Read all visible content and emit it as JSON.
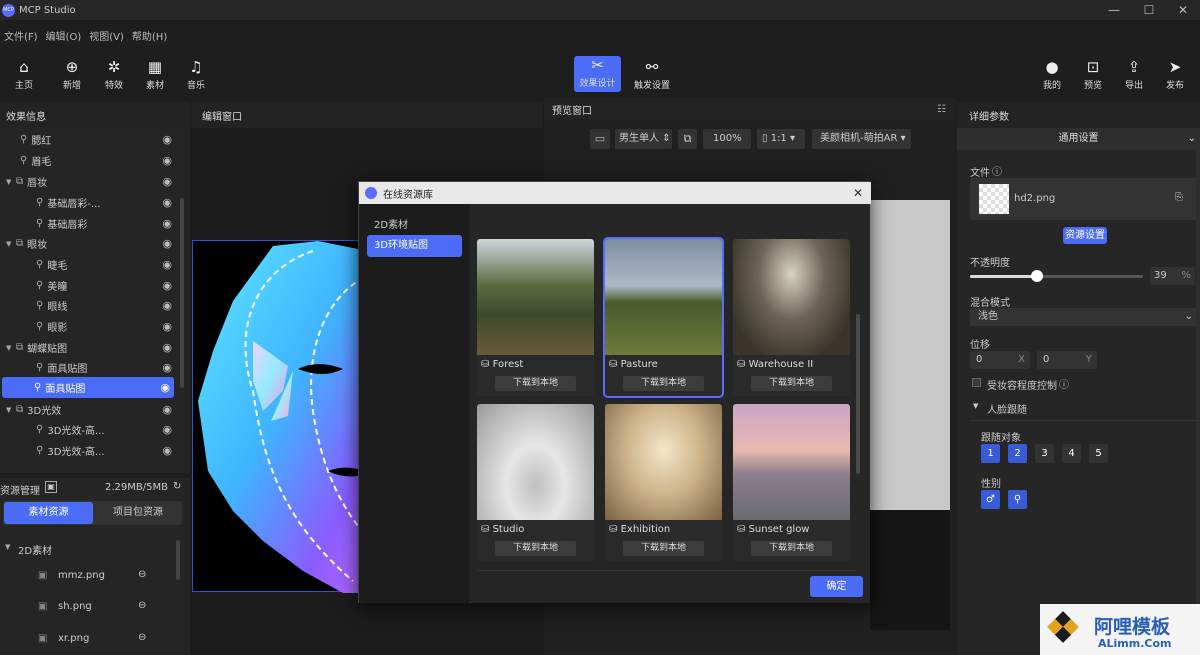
{
  "app": {
    "title": "MCP Studio",
    "logo_text": "MCP"
  },
  "window": {
    "minimize": "—",
    "maximize": "☐",
    "close": "✕"
  },
  "menu": [
    "文件(F)",
    "编辑(O)",
    "视图(V)",
    "帮助(H)"
  ],
  "toolbar": {
    "home": "主页",
    "add": "新增",
    "effect": "特效",
    "material": "素材",
    "music": "音乐",
    "effect_design": "效果设计",
    "trigger": "触发设置",
    "mine": "我的",
    "preview": "预览",
    "export": "导出",
    "publish": "发布"
  },
  "panels": {
    "effect_info": "效果信息",
    "edit_window": "编辑窗口",
    "preview_window": "预览窗口",
    "details": "详细参数"
  },
  "tree": [
    {
      "label": "腮红",
      "indent": 1
    },
    {
      "label": "眉毛",
      "indent": 1
    },
    {
      "label": "唇妆",
      "indent": 0
    },
    {
      "label": "基础唇彩-...",
      "indent": 2
    },
    {
      "label": "基础唇彩",
      "indent": 2
    },
    {
      "label": "眼妆",
      "indent": 0
    },
    {
      "label": "睫毛",
      "indent": 2
    },
    {
      "label": "美瞳",
      "indent": 2
    },
    {
      "label": "眼线",
      "indent": 2
    },
    {
      "label": "眼影",
      "indent": 2
    },
    {
      "label": "蝴蝶贴图",
      "indent": 0
    },
    {
      "label": "面具贴图",
      "indent": 2
    },
    {
      "label": "面具贴图",
      "indent": 1,
      "selected": true
    },
    {
      "label": "3D光效",
      "indent": 0
    },
    {
      "label": "3D光效-高...",
      "indent": 2
    },
    {
      "label": "3D光效-高...",
      "indent": 2
    }
  ],
  "resources": {
    "title": "资源管理",
    "size": "2.29MB/5MB",
    "tab_material": "素材资源",
    "tab_package": "项目包资源",
    "group": "2D素材",
    "files": [
      "mmz.png",
      "sh.png",
      "xr.png"
    ]
  },
  "preview_bar": {
    "mode": "男生单人",
    "zoom": "100%",
    "ratio": "1:1",
    "camera": "美颜相机-萌拍AR"
  },
  "dialog": {
    "title": "在线资源库",
    "side": [
      "2D素材",
      "3D环境贴图"
    ],
    "download_label": "下载到本地",
    "confirm": "确定",
    "items": [
      {
        "name": "Forest"
      },
      {
        "name": "Pasture",
        "selected": true
      },
      {
        "name": "Warehouse II"
      },
      {
        "name": "Studio"
      },
      {
        "name": "Exhibition"
      },
      {
        "name": "Sunset glow"
      }
    ]
  },
  "details": {
    "general": "通用设置",
    "file_label": "文件",
    "file_name": "hd2.png",
    "resource_settings": "资源设置",
    "opacity_label": "不透明度",
    "opacity_value": "39",
    "opacity_unit": "%",
    "opacity": 0.39,
    "blend_label": "混合模式",
    "blend_value": "浅色",
    "position_label": "位移",
    "pos_x": "0",
    "x": "X",
    "pos_y": "0",
    "y": "Y",
    "makeup_ctrl": "受妆容程度控制",
    "face_track": "人脸跟随",
    "follow_target": "跟随对象",
    "targets": [
      "1",
      "2",
      "3",
      "4",
      "5"
    ],
    "gender": "性别"
  },
  "watermark": {
    "cn": "阿哩模板",
    "en": "ALimm.Com"
  }
}
